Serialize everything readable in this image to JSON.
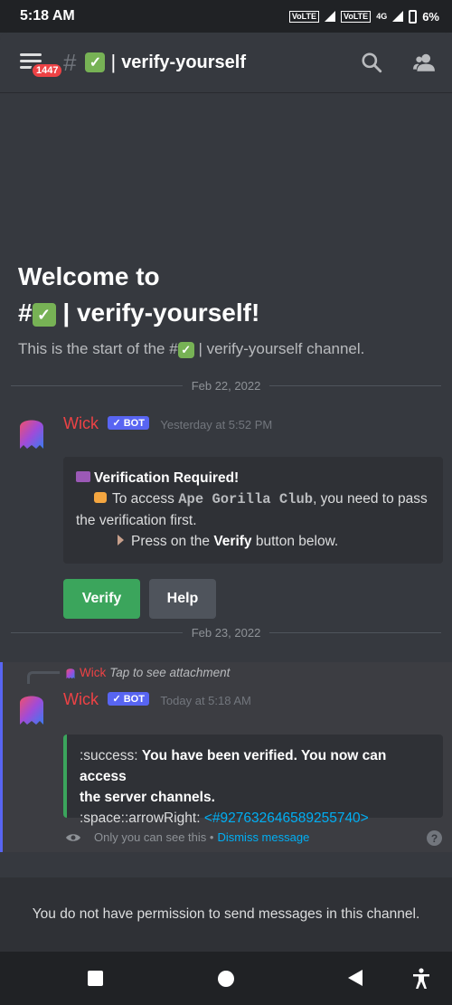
{
  "status_bar": {
    "time": "5:18 AM",
    "volte1": "VoLTE",
    "volte2": "VoLTE",
    "network": "4G",
    "battery": "6%"
  },
  "header": {
    "menu_badge": "1447",
    "hash": "#",
    "check": "✓",
    "pipe": "|",
    "channel_name": "verify-yourself",
    "icons": [
      "search-icon",
      "members-icon"
    ]
  },
  "welcome": {
    "title_prefix": "Welcome to",
    "title_hash": "#",
    "title_name": "verify-yourself!",
    "sub_before": "This is the start of the #",
    "sub_after": "verify-yourself channel."
  },
  "dates": {
    "first": "Feb 22, 2022",
    "second": "Feb 23, 2022"
  },
  "message1": {
    "author": "Wick",
    "bot_label": "✓ BOT",
    "timestamp": "Yesterday at 5:52 PM",
    "embed": {
      "title": "Verification Required!",
      "line1_prefix": "To access ",
      "server": "Ape Gorilla Club",
      "line1_suffix": ", you need to pass",
      "line2": "the verification first.",
      "line3_prefix": "Press on the ",
      "line3_bold": "Verify",
      "line3_suffix": " button below."
    },
    "buttons": {
      "verify": "Verify",
      "help": "Help"
    }
  },
  "message2": {
    "reply_author": "Wick",
    "reply_text": "Tap to see attachment",
    "author": "Wick",
    "bot_label": "✓ BOT",
    "timestamp": "Today at 5:18 AM",
    "embed": {
      "prefix1": ":success: ",
      "bold1": "You have been verified. You now can access",
      "bold2": "the server channels.",
      "prefix2": ":space::arrowRight: ",
      "channel_link": "<#927632646589255740>"
    },
    "only_you": "Only you can see this •",
    "dismiss": "Dismiss message"
  },
  "footer": {
    "permission_text": "You do not have permission to send messages in this channel."
  },
  "colors": {
    "background": "#36393f",
    "embed_bg": "#2f3136",
    "author": "#ed4245",
    "bot_badge": "#5865f2",
    "verify_button": "#3ba55c",
    "help_button": "#4f545c",
    "link": "#00aff4"
  }
}
